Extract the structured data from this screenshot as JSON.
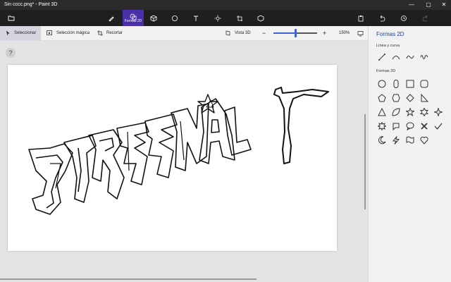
{
  "window": {
    "title": "Sin cccc.png* - Paint 3D",
    "controls": [
      "—",
      "▢",
      "✕"
    ]
  },
  "menubar": {
    "left_icon": "folder-icon",
    "tools": [
      "brushes-icon",
      "shapes-2d-icon",
      "shapes-3d-icon",
      "stickers-icon",
      "text-icon",
      "effects-icon",
      "canvas-icon",
      "library-icon"
    ],
    "active_tool_label": "Formas 2D",
    "right_icons": [
      "paste-icon",
      "undo-icon",
      "history-icon",
      "redo-icon"
    ]
  },
  "toolbar": {
    "select_label": "Seleccionar",
    "magic_select_label": "Selección mágica",
    "crop_label": "Recortar",
    "view3d_label": "Vista 3D",
    "zoom_minus": "−",
    "zoom_plus": "+",
    "zoom_value": "150%",
    "zoom_fraction": 0.5
  },
  "help_label": "?",
  "panel": {
    "title": "Formas 2D",
    "lines_section": "Línea y curva",
    "shapes_section": "Formas 2D",
    "line_tools": [
      "line-icon",
      "curve-icon",
      "polyline-icon",
      "bezier-icon"
    ],
    "shapes": [
      "ellipse",
      "rounded-capsule",
      "square",
      "rounded-square",
      "pentagon",
      "hexagon",
      "diamond",
      "right-triangle",
      "triangle",
      "leaf",
      "star-5",
      "star-6",
      "star-4",
      "starburst",
      "speech-bubble-round",
      "speech-bubble-rect",
      "cross",
      "checkmark",
      "moon",
      "lightning",
      "wavy-flag",
      "heart"
    ]
  },
  "colors": {
    "accent": "#4b2fa8",
    "panel_title": "#1f3f8f",
    "titlebar": "#2b2b2b",
    "menubar": "#1f1f1f"
  }
}
